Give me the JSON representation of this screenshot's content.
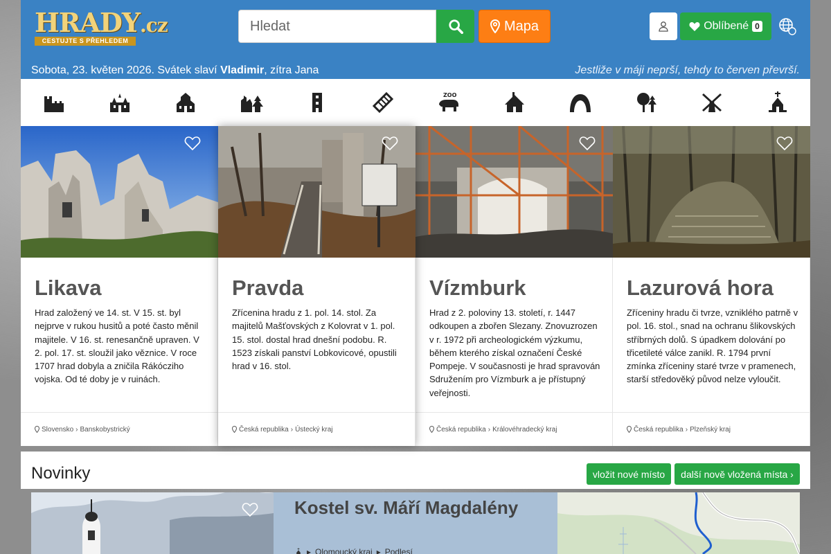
{
  "header": {
    "logo_main": "HRADY",
    "logo_tld": ".cz",
    "logo_tagline": "CESTUJTE S PŘEHLEDEM",
    "search_placeholder": "Hledat",
    "map_label": "Mapa",
    "favorites_label": "Oblíbené",
    "favorites_count": "0",
    "date_prefix": "Sobota, 23. květen 2026. Svátek slaví ",
    "name_today": "Vladimir",
    "name_tomorrow_text": ", zítra Jana",
    "proverb": "Jestliže v máji neprší, tehdy to červen převrší."
  },
  "categories": [
    {
      "icon": "castle-icon"
    },
    {
      "icon": "chateau-icon"
    },
    {
      "icon": "church-icon"
    },
    {
      "icon": "ruin-icon"
    },
    {
      "icon": "tower-icon"
    },
    {
      "icon": "bridge-icon"
    },
    {
      "icon": "zoo-icon"
    },
    {
      "icon": "folk-building-icon"
    },
    {
      "icon": "cave-icon"
    },
    {
      "icon": "nature-icon"
    },
    {
      "icon": "windmill-icon"
    },
    {
      "icon": "chapel-icon"
    }
  ],
  "cards": [
    {
      "name": "Likava",
      "description": "Hrad založený ve 14. st. V 15. st. byl nejprve v rukou husitů a poté často měnil majitele. V 16. st. renesančně upraven. V 2. pol. 17. st. sloužil jako věznice. V roce 1707 hrad dobyla a zničila Rákócziho vojska. Od té doby je v ruinách.",
      "country": "Slovensko",
      "region": "Banskobystrický"
    },
    {
      "name": "Pravda",
      "description": "Zřícenina hradu z 1. pol. 14. stol. Za majitelů Mašťovských z Kolovrat v 1. pol. 15. stol. dostal hrad dnešní podobu. R. 1523 získali panství Lobkovicové, opustili hrad v 16. stol.",
      "country": "Česká republika",
      "region": "Ústecký kraj"
    },
    {
      "name": "Vízmburk",
      "description": "Hrad z 2. poloviny 13. století, r. 1447 odkoupen a zbořen Slezany. Znovuzrozen v r. 1972 při archeologickém výzkumu, během kterého získal označení České Pompeje. V současnosti je hrad spravován Sdružením pro Vízmburk a je přístupný veřejnosti.",
      "country": "Česká republika",
      "region": "Královéhradecký kraj"
    },
    {
      "name": "Lazurová hora",
      "description": "Zříceniny hradu či tvrze, vzniklého patrně v pol. 16. stol., snad na ochranu šlikovských stříbrných dolů. S úpadkem dolování po třicetileté válce zanikl. R. 1794 první zmínka zříceniny staré tvrze v pramenech, starší středověký původ nelze vyloučit.",
      "country": "Česká republika",
      "region": "Plzeňský kraj"
    }
  ],
  "news": {
    "title": "Novinky",
    "new_place_label": "vložit nové místo",
    "more_label": "další nově vložená místa",
    "item": {
      "name": "Kostel sv. Máří Magdalény",
      "region": "Olomoucký kraj",
      "subregion": "Podlesí"
    }
  },
  "colors": {
    "header_blue": "#3a82c4",
    "green": "#28a745",
    "orange": "#fd7e14"
  }
}
